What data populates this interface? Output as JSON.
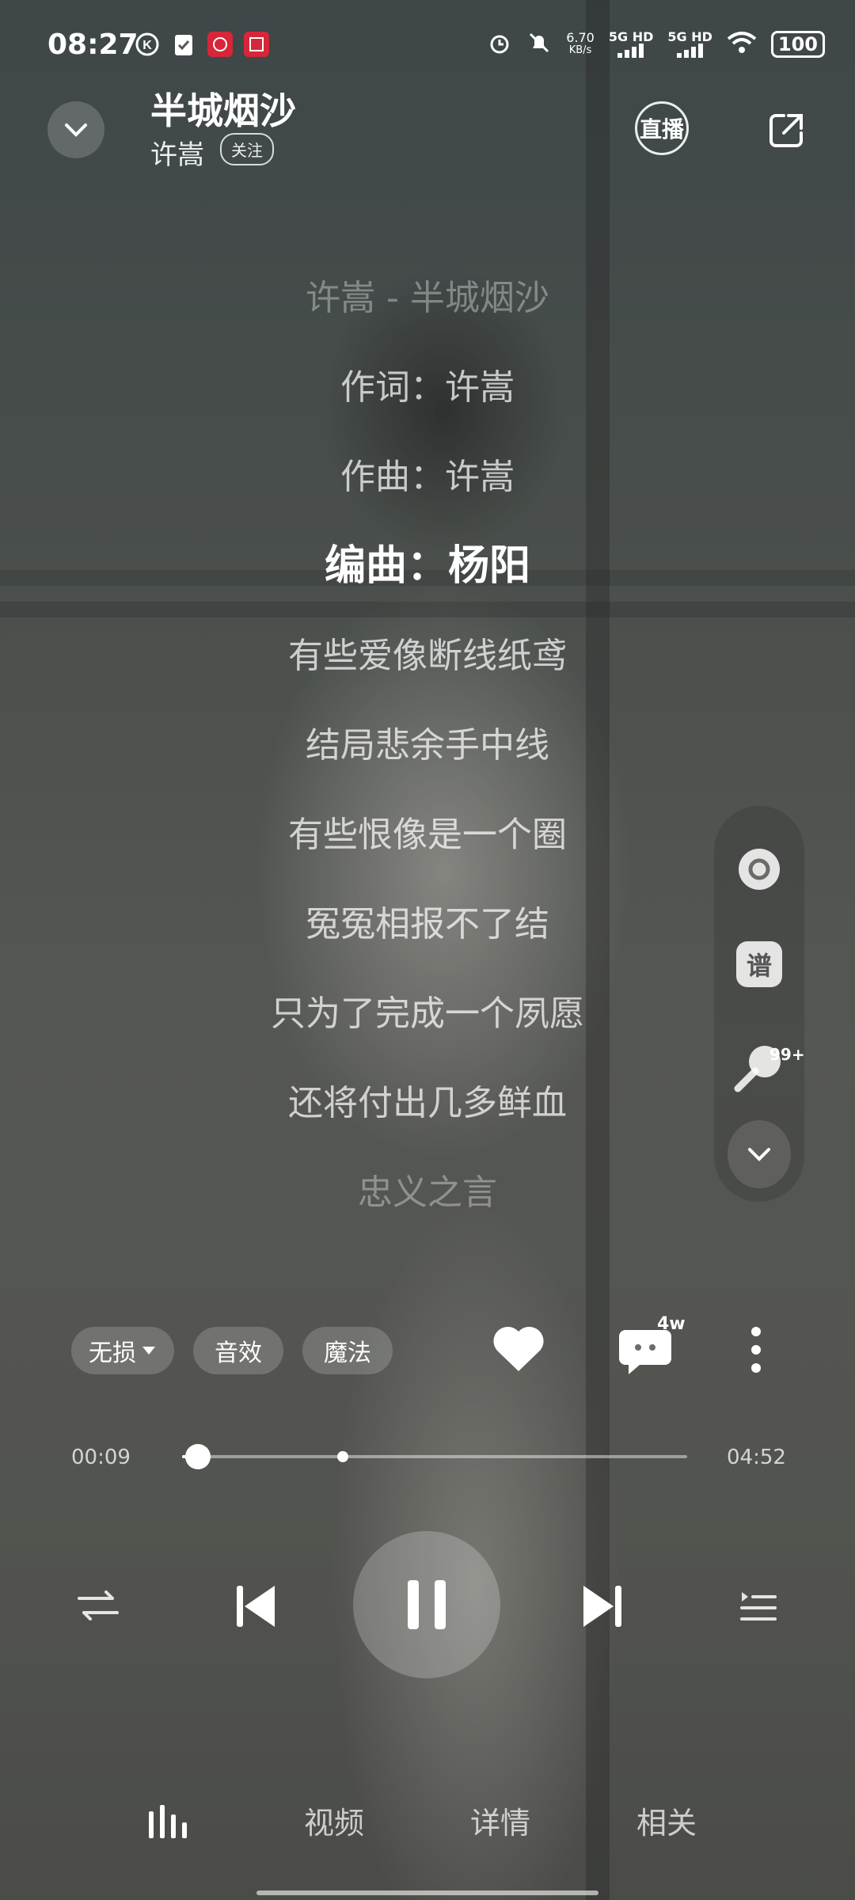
{
  "status_bar": {
    "time": "08:27",
    "net_speed": "6.70",
    "net_unit": "KB/s",
    "sim1": "5G HD",
    "sim2": "5G HD",
    "battery": "100"
  },
  "header": {
    "title": "半城烟沙",
    "artist": "许嵩",
    "follow_label": "关注",
    "live_label": "直播"
  },
  "lyrics": [
    {
      "text": "许嵩 - 半城烟沙",
      "state": "faint"
    },
    {
      "text": "作词：许嵩",
      "state": "normal"
    },
    {
      "text": "作曲：许嵩",
      "state": "normal"
    },
    {
      "text": "编曲：杨阳",
      "state": "active"
    },
    {
      "text": "有些爱像断线纸鸢",
      "state": "normal"
    },
    {
      "text": "结局悲余手中线",
      "state": "normal"
    },
    {
      "text": "有些恨像是一个圈",
      "state": "normal"
    },
    {
      "text": "冤冤相报不了结",
      "state": "normal"
    },
    {
      "text": "只为了完成一个夙愿",
      "state": "normal"
    },
    {
      "text": "还将付出几多鲜血",
      "state": "normal"
    },
    {
      "text": "忠义之言",
      "state": "faint"
    }
  ],
  "side_panel": {
    "score_label": "谱",
    "badge": "99+"
  },
  "controls": {
    "quality_label": "无损",
    "effects_label": "音效",
    "magic_label": "魔法",
    "comment_count": "4w"
  },
  "progress": {
    "current": "00:09",
    "total": "04:52",
    "fraction": 0.031
  },
  "tabs": {
    "video": "视频",
    "details": "详情",
    "related": "相关"
  },
  "colors": {
    "accent": "#ffffff"
  }
}
